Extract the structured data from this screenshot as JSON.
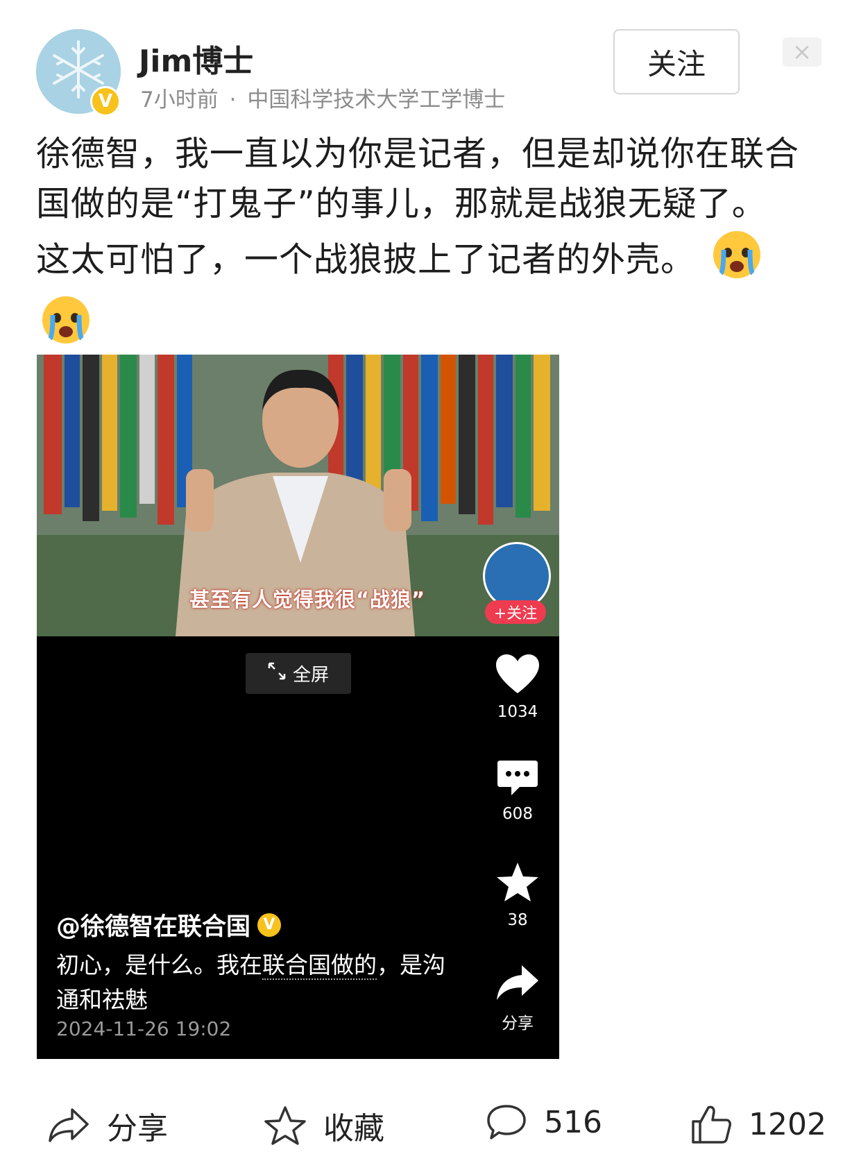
{
  "author": {
    "name": "Jim博士",
    "time": "7小时前",
    "separator": "·",
    "bio": "中国科学技术大学工学博士",
    "verified_badge": "V"
  },
  "header": {
    "follow_label": "关注",
    "close_icon": "close-icon"
  },
  "post": {
    "text": "徐德智，我一直以为你是记者，但是却说你在联合国做的是“打鬼子”的事儿，那就是战狼无疑了。这太可怕了，一个战狼披上了记者的外壳。",
    "emoji": "crying-face-emoji"
  },
  "video": {
    "subtitle": "甚至有人觉得我很“战狼”",
    "creator_follow": "+关注",
    "fullscreen_label": "全屏",
    "likes": "1034",
    "comments": "608",
    "favorites": "38",
    "share_label": "分享",
    "author_handle": "@徐德智在联合国",
    "desc_part1": "初心，是什么。我在",
    "desc_link": "联合国做的",
    "desc_part2": "，是沟通和祛魅",
    "date": "2024-11-26 19:02"
  },
  "actions": {
    "share_label": "分享",
    "favorite_label": "收藏",
    "comment_count": "516",
    "like_count": "1202"
  },
  "colors": {
    "verified": "#f7c21b",
    "follow_red": "#ef3b50"
  }
}
